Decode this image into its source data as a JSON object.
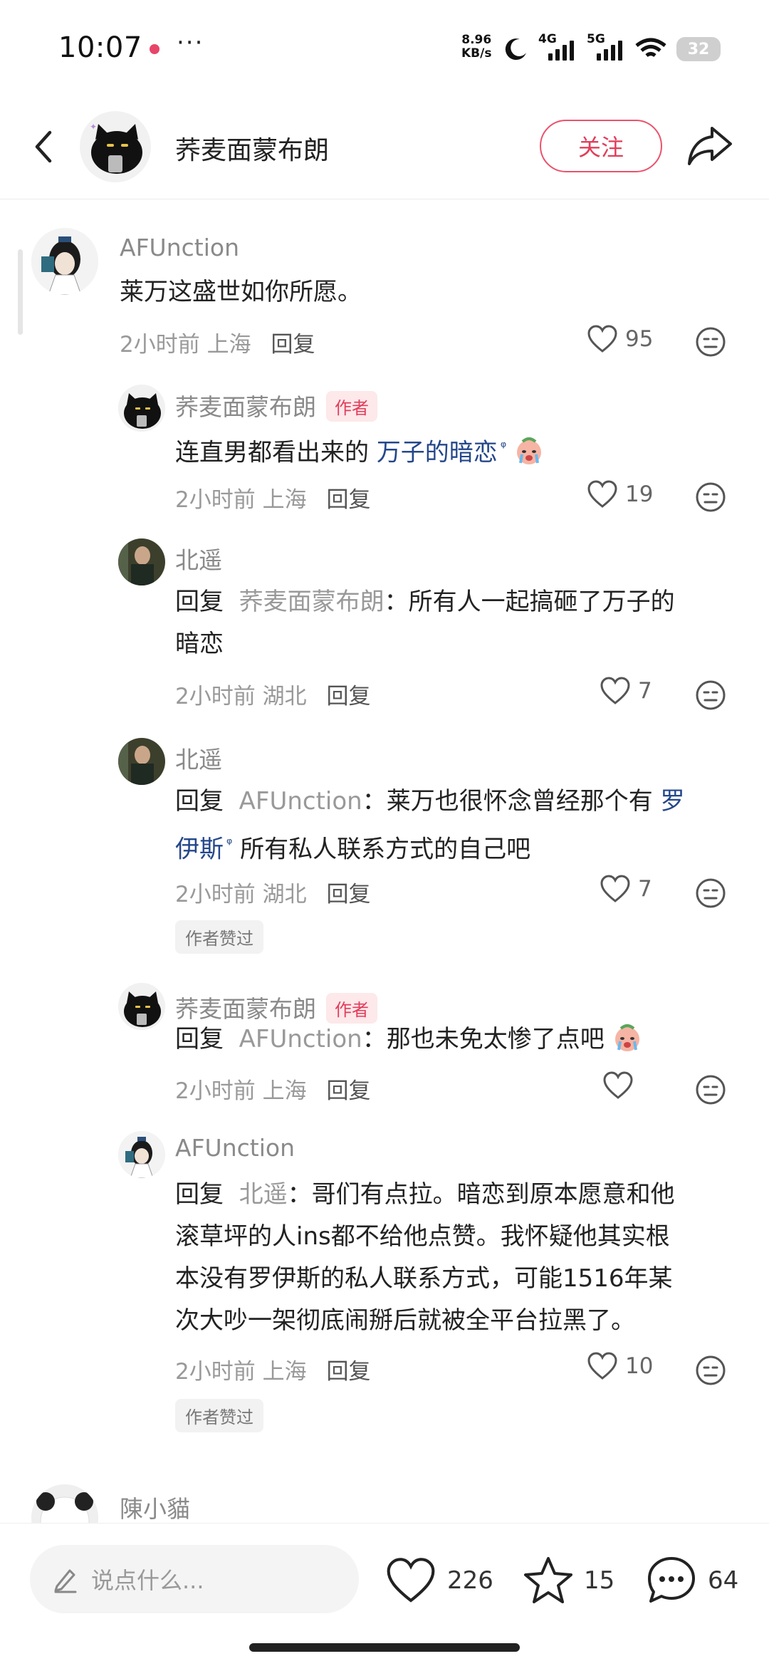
{
  "status_bar": {
    "time": "10:07",
    "more": "···",
    "speed_value": "8.96",
    "speed_unit": "KB/s",
    "network_4g": "4G",
    "network_5g": "5G",
    "battery": "32"
  },
  "header": {
    "name": "荞麦面蒙布朗",
    "follow_label": "关注"
  },
  "comments": [
    {
      "name": "AFUnction",
      "text": "莱万这盛世如你所愿。",
      "time": "2小时前",
      "location": "上海",
      "reply": "回复",
      "likes": "95"
    },
    {
      "name": "荞麦面蒙布朗",
      "tag": "作者",
      "text_prefix": "连直男都看出来的",
      "link": "万子的暗恋",
      "time": "2小时前",
      "location": "上海",
      "reply": "回复",
      "likes": "19"
    },
    {
      "name": "北遥",
      "reply_word": "回复",
      "reply_to": "荞麦面蒙布朗",
      "text_line1": "：所有人一起搞砸了万子的",
      "text_line2": "暗恋",
      "time": "2小时前",
      "location": "湖北",
      "reply": "回复",
      "likes": "7"
    },
    {
      "name": "北遥",
      "reply_word": "回复",
      "reply_to": "AFUnction",
      "text_line1": "：莱万也很怀念曾经那个有",
      "link_part1": "罗",
      "link_part2": "伊斯",
      "text_line2": "所有私人联系方式的自己吧",
      "time": "2小时前",
      "location": "湖北",
      "reply": "回复",
      "likes": "7",
      "badge": "作者赞过"
    },
    {
      "name": "荞麦面蒙布朗",
      "tag": "作者",
      "reply_word": "回复",
      "reply_to": "AFUnction",
      "text": "：那也未免太惨了点吧",
      "time": "2小时前",
      "location": "上海",
      "reply": "回复"
    },
    {
      "name": "AFUnction",
      "reply_word": "回复",
      "reply_to": "北遥",
      "line1": "：哥们有点拉。暗恋到原本愿意和他",
      "line2": "滚草坪的人ins都不给他点赞。我怀疑他其实根",
      "line3": "本没有罗伊斯的私人联系方式，可能1516年某",
      "line4": "次大吵一架彻底闹掰后就被全平台拉黑了。",
      "time": "2小时前",
      "location": "上海",
      "reply": "回复",
      "likes": "10",
      "badge": "作者赞过"
    },
    {
      "name": "陳小貓"
    }
  ],
  "bottom_bar": {
    "input_placeholder": "说点什么...",
    "likes": "226",
    "stars": "15",
    "comments": "64"
  }
}
